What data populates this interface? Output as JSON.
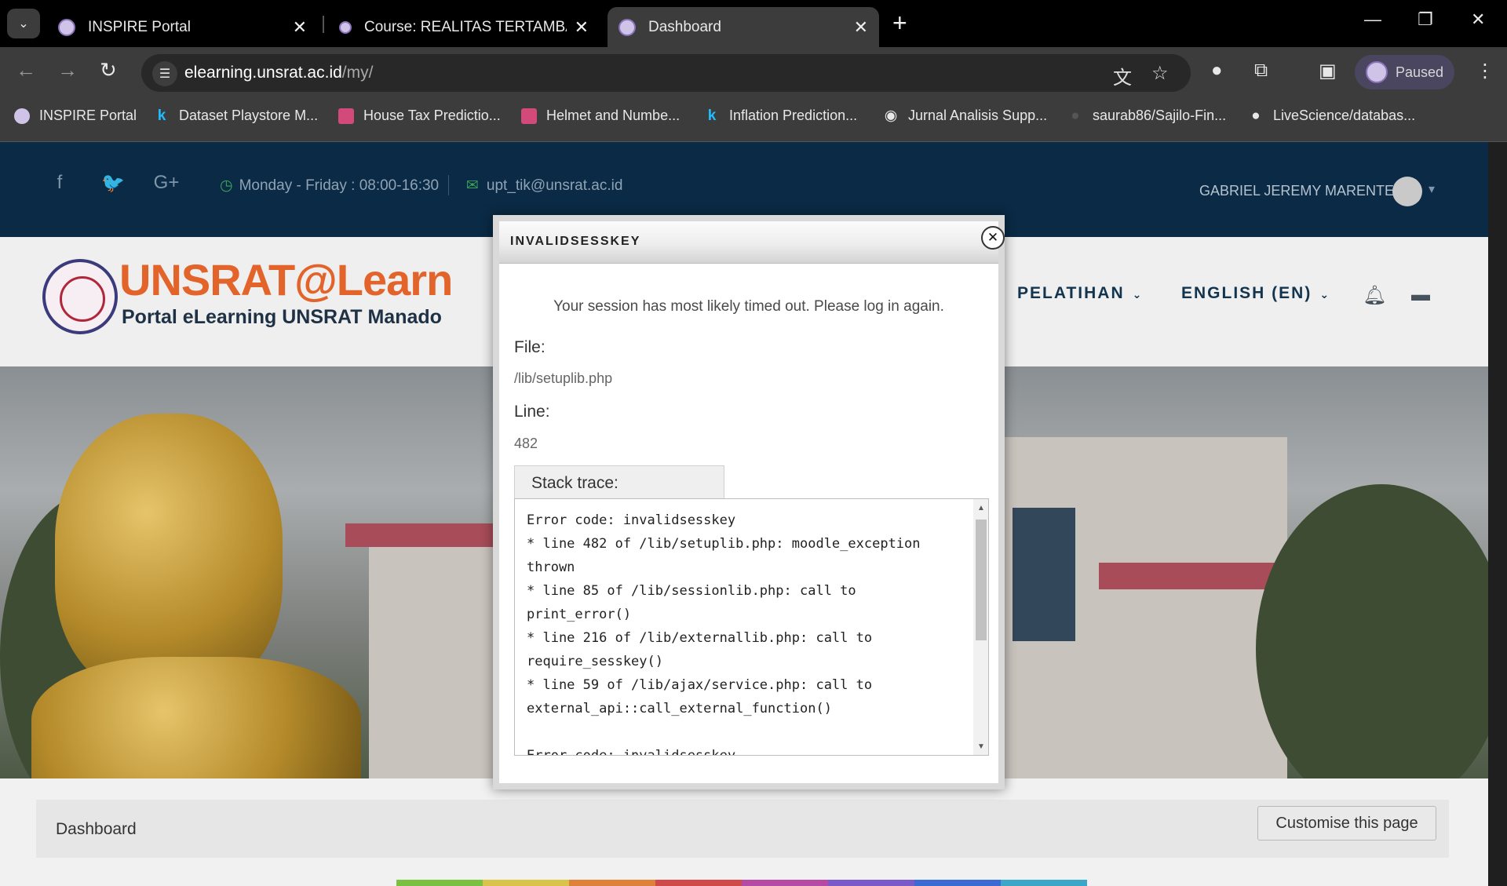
{
  "browser": {
    "tabs": [
      {
        "title": "INSPIRE Portal"
      },
      {
        "title": "Course: REALITAS TERTAMBAH DAN REALITAS MAYA"
      },
      {
        "title": "Dashboard"
      }
    ],
    "url_host": "elearning.unsrat.ac.id",
    "url_path": "/my/",
    "profile_status": "Paused",
    "bookmarks": [
      "INSPIRE Portal",
      "Dataset Playstore M...",
      "House Tax Predictio...",
      "Helmet and Numbe...",
      "Inflation Prediction...",
      "Jurnal Analisis Supp...",
      "saurab86/Sajilo-Fin...",
      "LiveScience/databas..."
    ]
  },
  "topbar": {
    "hours": "Monday - Friday : 08:00-16:30",
    "email": "upt_tik@unsrat.ac.id",
    "user": "GABRIEL JEREMY MARENTEK"
  },
  "brand": {
    "title": "UNSRAT@Learn",
    "subtitle": "Portal eLearning UNSRAT Manado"
  },
  "nav": {
    "pelatihan": "PELATIHAN",
    "language": "ENGLISH (EN)"
  },
  "crumb": {
    "label": "Dashboard",
    "customise": "Customise this page"
  },
  "modal": {
    "title": "INVALIDSESSKEY",
    "message": "Your session has most likely timed out. Please log in again.",
    "file_label": "File:",
    "file_value": "/lib/setuplib.php",
    "line_label": "Line:",
    "line_value": "482",
    "stack_label": "Stack trace:",
    "stack_text": "Error code: invalidsesskey\n* line 482 of /lib/setuplib.php: moodle_exception thrown\n* line 85 of /lib/sessionlib.php: call to print_error()\n* line 216 of /lib/externallib.php: call to require_sesskey()\n* line 59 of /lib/ajax/service.php: call to external_api::call_external_function()\n\nError code: invalidsesskey"
  },
  "colors": {
    "topbar": "#0a2a45",
    "brand_orange": "#e2642a",
    "nav_text": "#13344f"
  }
}
